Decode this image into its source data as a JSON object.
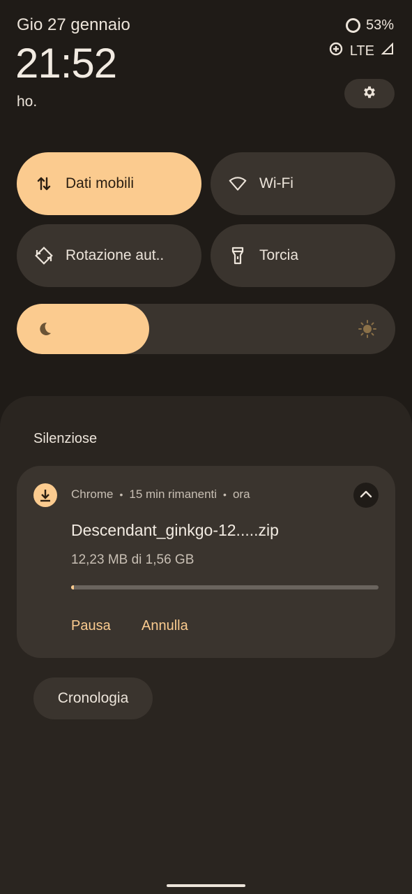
{
  "status": {
    "date": "Gio 27 gennaio",
    "time": "21:52",
    "carrier": "ho.",
    "battery": "53%",
    "network": "LTE"
  },
  "quick_settings": {
    "tiles": [
      {
        "label": "Dati mobili",
        "icon": "swap-vert-icon",
        "active": true
      },
      {
        "label": "Wi-Fi",
        "icon": "wifi-icon",
        "active": false
      },
      {
        "label": "Rotazione aut..",
        "icon": "rotate-icon",
        "active": false
      },
      {
        "label": "Torcia",
        "icon": "flashlight-icon",
        "active": false
      }
    ],
    "brightness": {
      "level": 0.35
    }
  },
  "notifications": {
    "section_title": "Silenziose",
    "items": [
      {
        "app": "Chrome",
        "remaining": "15 min rimanenti",
        "when": "ora",
        "title": "Descendant_ginkgo-12.....zip",
        "subtitle": "12,23 MB di 1,56 GB",
        "progress": 0.008,
        "actions": [
          "Pausa",
          "Annulla"
        ]
      }
    ],
    "history_label": "Cronologia"
  },
  "colors": {
    "background": "#1f1b17",
    "surface": "#3a342e",
    "accent": "#fbcb8f"
  }
}
